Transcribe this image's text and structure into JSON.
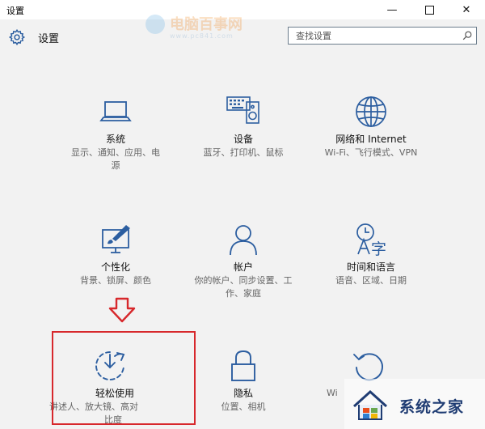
{
  "window": {
    "title": "设置",
    "minimize_glyph": "—",
    "close_glyph": "✕"
  },
  "header": {
    "title": "设置",
    "icon": "gear-icon"
  },
  "search": {
    "placeholder": "查找设置",
    "value": ""
  },
  "watermark": {
    "text": "电脑百事网",
    "sub": "www.pc841.com"
  },
  "tiles": [
    {
      "id": "system",
      "icon": "laptop-icon",
      "title": "系统",
      "desc_lines": [
        "显示、通知、应用、电",
        "源"
      ]
    },
    {
      "id": "devices",
      "icon": "keyboard-speaker-icon",
      "title": "设备",
      "desc_lines": [
        "蓝牙、打印机、鼠标"
      ]
    },
    {
      "id": "network",
      "icon": "globe-icon",
      "title": "网络和 Internet",
      "desc_lines": [
        "Wi-Fi、飞行模式、VPN"
      ]
    },
    {
      "id": "personalization",
      "icon": "paint-brush-icon",
      "title": "个性化",
      "desc_lines": [
        "背景、锁屏、颜色"
      ]
    },
    {
      "id": "accounts",
      "icon": "person-icon",
      "title": "帐户",
      "desc_lines": [
        "你的帐户、同步设置、工",
        "作、家庭"
      ]
    },
    {
      "id": "time_language",
      "icon": "time-language-icon",
      "title": "时间和语言",
      "desc_lines": [
        "语音、区域、日期"
      ]
    },
    {
      "id": "ease_of_access",
      "icon": "ease-of-access-icon",
      "title": "轻松使用",
      "desc_lines": [
        "讲述人、放大镜、高对",
        "比度"
      ]
    },
    {
      "id": "privacy",
      "icon": "lock-icon",
      "title": "隐私",
      "desc_lines": [
        "位置、相机"
      ]
    },
    {
      "id": "update_security",
      "icon": "refresh-icon",
      "title": "",
      "desc_lines": [
        "Wi"
      ]
    }
  ],
  "annotation": {
    "arrow_icon": "down-arrow-icon",
    "highlight_color": "#d7282c"
  },
  "logo_badge": {
    "text": "系统之家"
  },
  "colors": {
    "background": "#f2f2f2",
    "accent": "#2c5ea0",
    "title_text": "#111111",
    "description_text": "#666666"
  }
}
